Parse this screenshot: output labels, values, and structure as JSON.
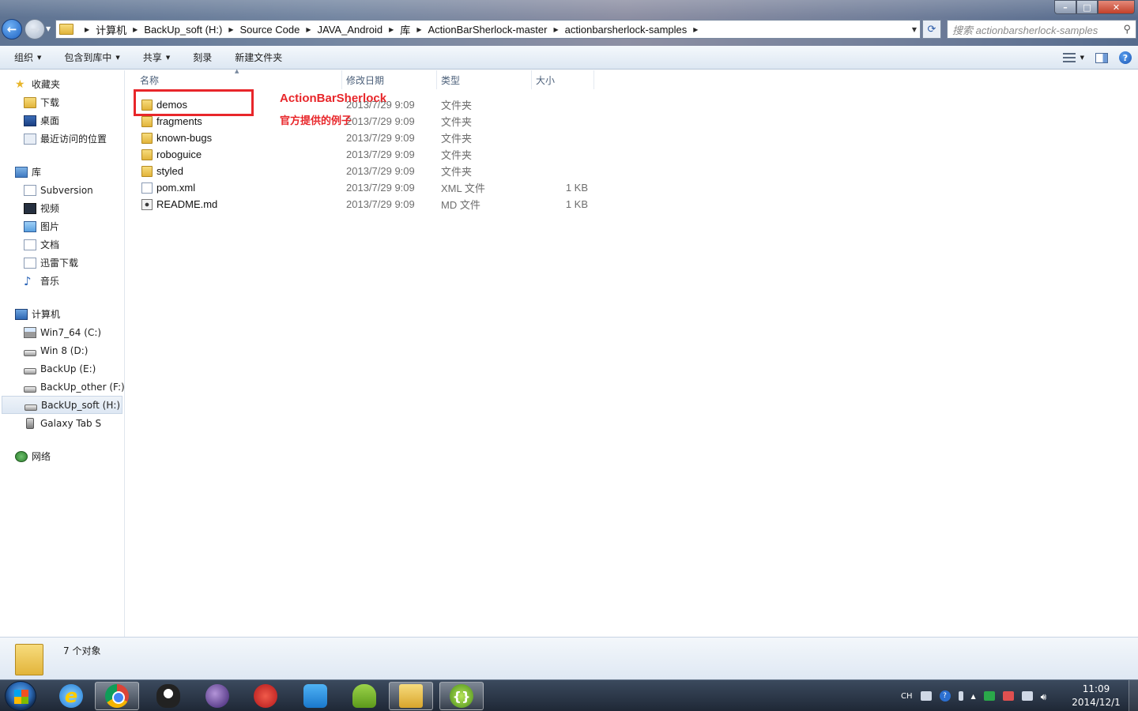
{
  "window": {
    "minimize_label": "–",
    "maximize_label": "□",
    "close_label": "✕"
  },
  "address": {
    "crumbs": [
      "计算机",
      "BackUp_soft (H:)",
      "Source Code",
      "JAVA_Android",
      "库",
      "ActionBarSherlock-master",
      "actionbarsherlock-samples"
    ]
  },
  "search": {
    "placeholder": "搜索 actionbarsherlock-samples"
  },
  "toolbar": {
    "organize": "组织",
    "include_in_library": "包含到库中",
    "share": "共享",
    "burn": "刻录",
    "new_folder": "新建文件夹"
  },
  "sidebar": {
    "favorites": {
      "label": "收藏夹",
      "items": [
        "下载",
        "桌面",
        "最近访问的位置"
      ]
    },
    "libraries": {
      "label": "库",
      "items": [
        "Subversion",
        "视频",
        "图片",
        "文档",
        "迅雷下载",
        "音乐"
      ]
    },
    "computer": {
      "label": "计算机",
      "items": [
        "Win7_64 (C:)",
        "Win 8 (D:)",
        "BackUp (E:)",
        "BackUp_other (F:)",
        "BackUp_soft (H:)",
        "Galaxy Tab S"
      ]
    },
    "network": {
      "label": "网络"
    }
  },
  "columns": {
    "name": "名称",
    "date": "修改日期",
    "type": "类型",
    "size": "大小"
  },
  "files": [
    {
      "name": "demos",
      "date": "2013/7/29 9:09",
      "type": "文件夹",
      "size": ""
    },
    {
      "name": "fragments",
      "date": "2013/7/29 9:09",
      "type": "文件夹",
      "size": ""
    },
    {
      "name": "known-bugs",
      "date": "2013/7/29 9:09",
      "type": "文件夹",
      "size": ""
    },
    {
      "name": "roboguice",
      "date": "2013/7/29 9:09",
      "type": "文件夹",
      "size": ""
    },
    {
      "name": "styled",
      "date": "2013/7/29 9:09",
      "type": "文件夹",
      "size": ""
    },
    {
      "name": "pom.xml",
      "date": "2013/7/29 9:09",
      "type": "XML 文件",
      "size": "1 KB"
    },
    {
      "name": "README.md",
      "date": "2013/7/29 9:09",
      "type": "MD 文件",
      "size": "1 KB"
    }
  ],
  "annotation": {
    "line1": "ActionBarSherlock",
    "line2": "官方提供的例子",
    "color": "#e8262a"
  },
  "status": {
    "count": "7 个对象"
  },
  "taskbar": {
    "lang": "CH",
    "time": "11:09",
    "date": "2014/12/1"
  }
}
